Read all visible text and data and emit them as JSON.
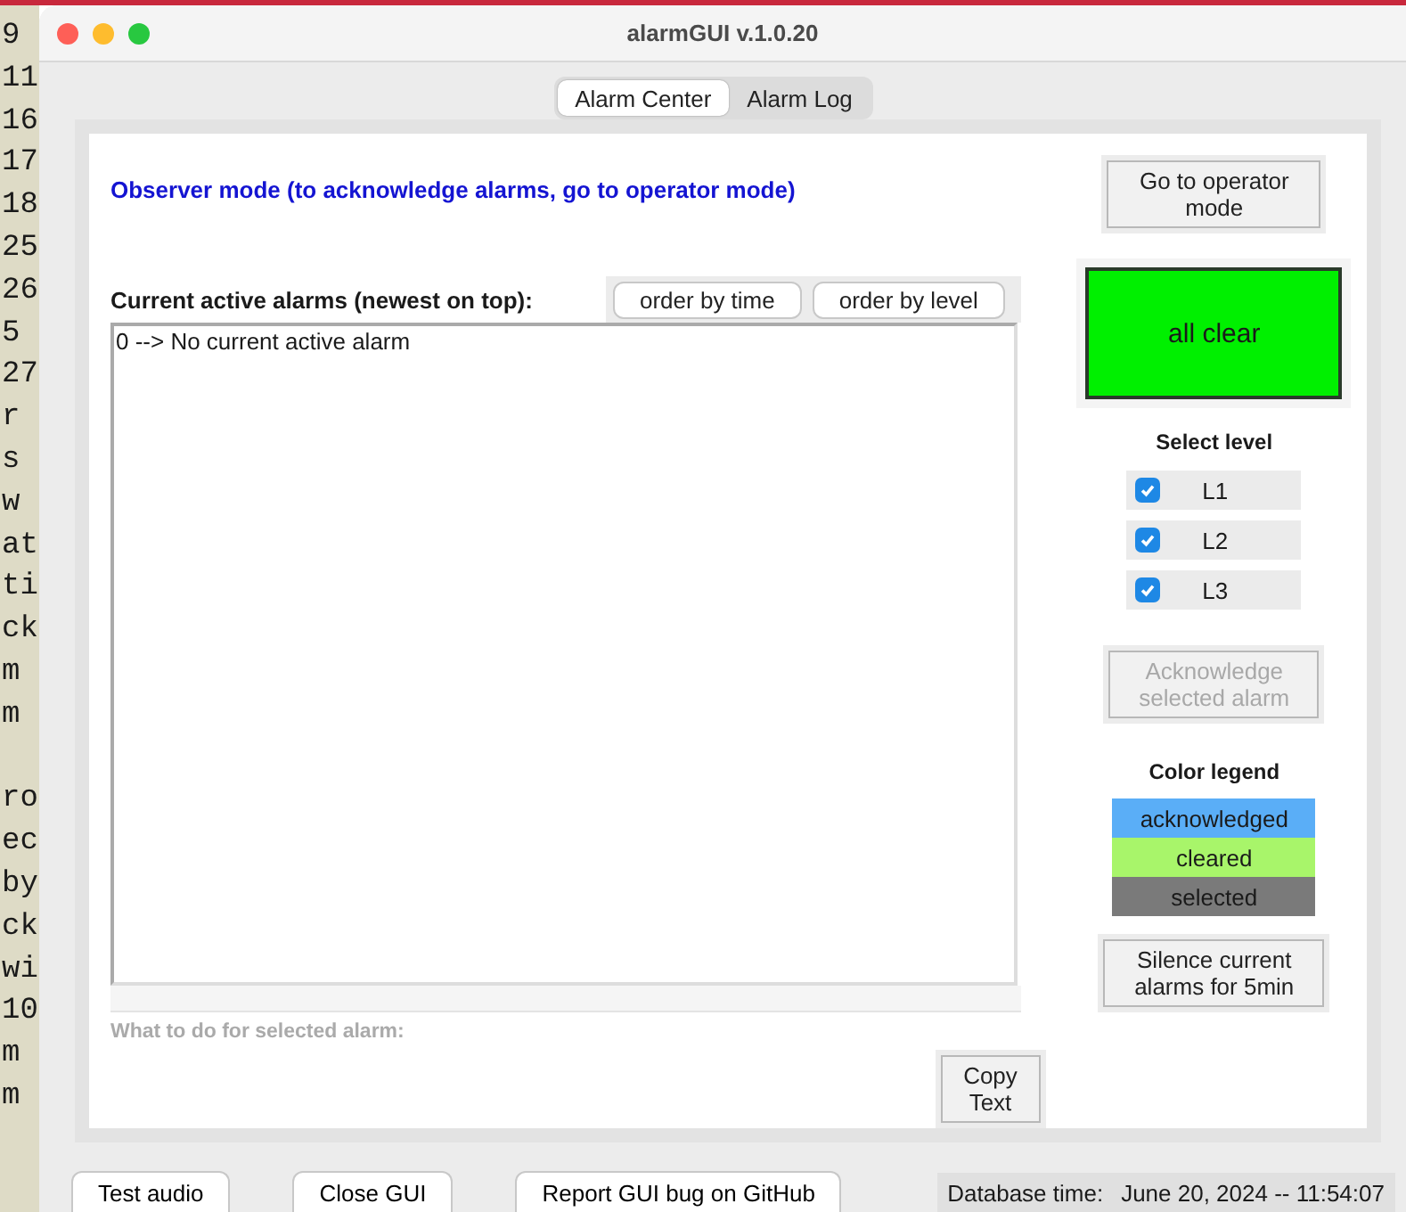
{
  "terminal": {
    "blocks": [
      [
        "9",
        "11",
        "16",
        "17",
        "18",
        "25",
        "26",
        "5",
        "27",
        "r",
        "s",
        "w",
        "at",
        "ti",
        "ck",
        "m",
        "m"
      ],
      [
        "ro",
        "ec",
        "by",
        "ck",
        "wi",
        "10",
        "m",
        "m"
      ]
    ]
  },
  "window": {
    "title": "alarmGUI v.1.0.20"
  },
  "tabs": [
    {
      "label": "Alarm Center",
      "selected": true
    },
    {
      "label": "Alarm Log",
      "selected": false
    }
  ],
  "mode_message": "Observer mode (to acknowledge alarms, go to operator mode)",
  "operator_button": "Go to operator mode",
  "alarm_list": {
    "heading": "Current active alarms (newest on top):",
    "sort_buttons": [
      "order by time",
      "order by level"
    ],
    "rows": [
      "0 --> No current active alarm"
    ]
  },
  "action_label": "What to do for selected alarm:",
  "copy_button": "Copy Text",
  "status": {
    "label": "all clear",
    "color": "#00f000"
  },
  "level_filter": {
    "heading": "Select level",
    "levels": [
      {
        "label": "L1",
        "checked": true
      },
      {
        "label": "L2",
        "checked": true
      },
      {
        "label": "L3",
        "checked": true
      }
    ]
  },
  "acknowledge_button": {
    "label": "Acknowledge selected alarm",
    "disabled": true
  },
  "legend": {
    "heading": "Color legend",
    "items": [
      {
        "label": "acknowledged",
        "color": "#5aaef7"
      },
      {
        "label": "cleared",
        "color": "#a8f56a"
      },
      {
        "label": "selected",
        "color": "#7a7a7a"
      }
    ]
  },
  "silence_button": "Silence current alarms for 5min",
  "footer": {
    "buttons": [
      "Test audio",
      "Close GUI",
      "Report GUI bug on GitHub"
    ],
    "database_time_label": "Database time:",
    "database_time": "June 20, 2024 -- 11:54:07"
  }
}
